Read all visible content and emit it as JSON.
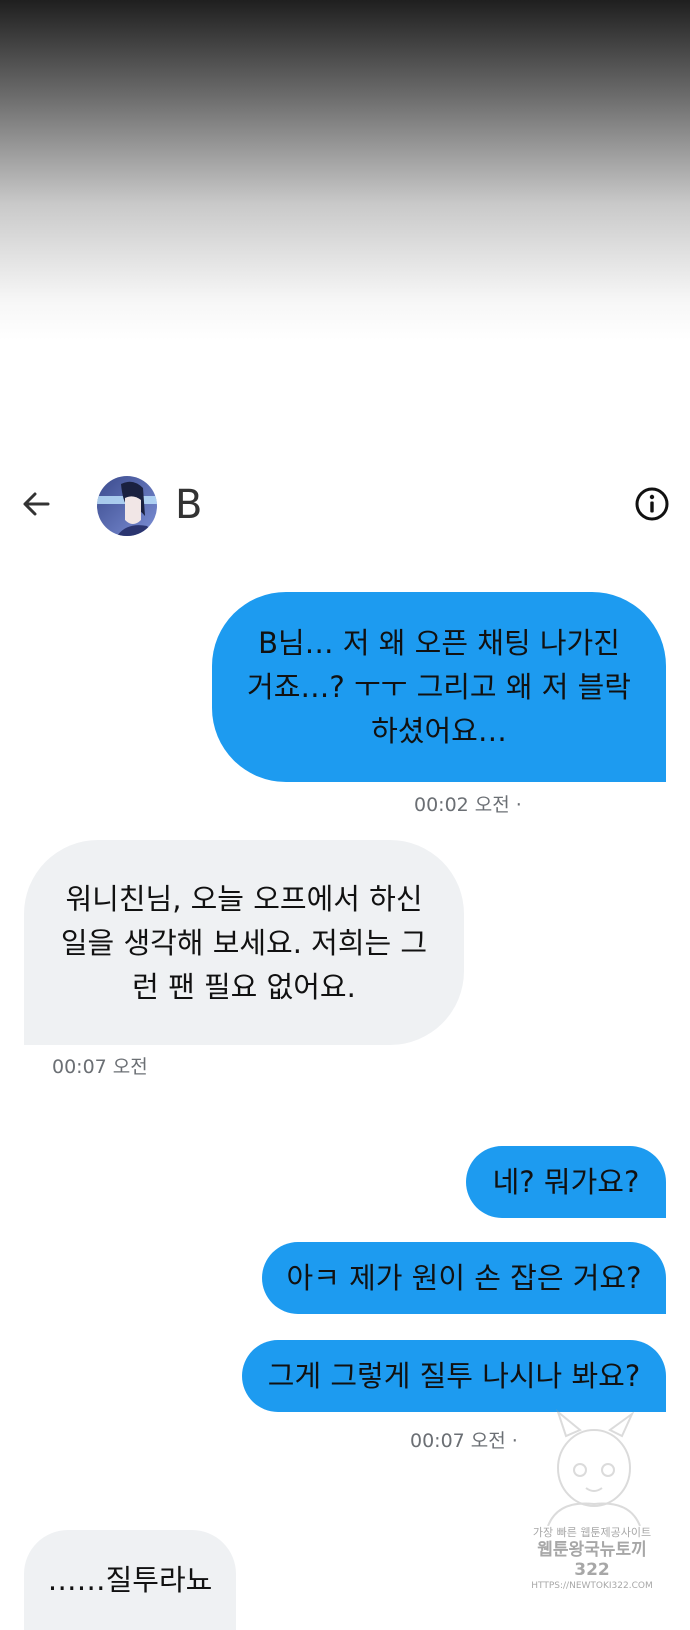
{
  "header": {
    "contact_name": "B",
    "back_icon": "arrow-left-icon",
    "info_icon": "info-circle-icon"
  },
  "messages": [
    {
      "direction": "sent",
      "lines": [
        "B님… 저 왜 오픈 채팅 나가진",
        "거죠…? ㅜㅜ 그리고 왜 저 블락",
        "하셨어요…"
      ],
      "timestamp": "00:02 오전 ·"
    },
    {
      "direction": "received",
      "lines": [
        "워니친님, 오늘 오프에서 하신",
        "일을 생각해 보세요. 저희는 그",
        "런 팬 필요 없어요."
      ],
      "timestamp": "00:07 오전"
    },
    {
      "direction": "sent",
      "lines": [
        "네? 뭐가요?"
      ]
    },
    {
      "direction": "sent",
      "lines": [
        "아ㅋ 제가 원이 손 잡은 거요?"
      ]
    },
    {
      "direction": "sent",
      "lines": [
        "그게 그렇게 질투 나시나 봐요?"
      ],
      "timestamp": "00:07 오전 ·"
    },
    {
      "direction": "received",
      "lines": [
        "……질투라뇨"
      ]
    }
  ],
  "watermark": {
    "line1": "가장 빠른 웹툰제공사이트",
    "line2": "웹툰왕국뉴토끼322",
    "line3": "HTTPS://NEWTOKI322.COM"
  },
  "colors": {
    "sent_bubble": "#1d9bf0",
    "received_bubble": "#eff1f3",
    "timestamp": "#6b6f74"
  }
}
